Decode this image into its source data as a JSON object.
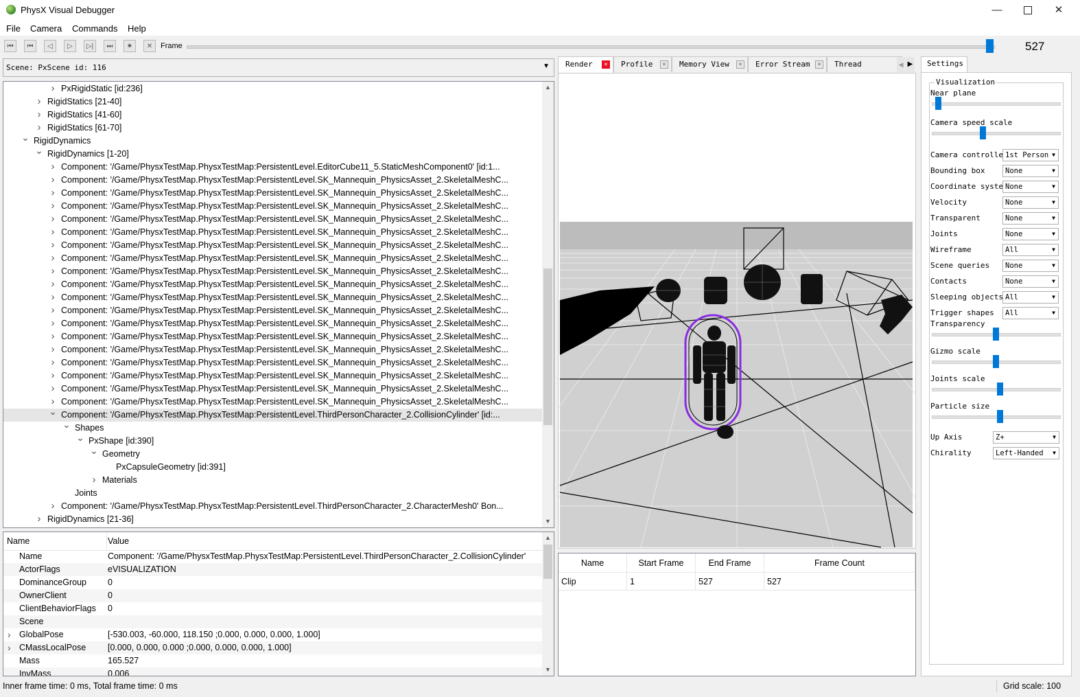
{
  "window": {
    "title": "PhysX Visual Debugger",
    "minimize": "—",
    "maximize": "☐",
    "close": "✕"
  },
  "menu": [
    "File",
    "Camera",
    "Commands",
    "Help"
  ],
  "toolbar": {
    "frame_label": "Frame",
    "frame_value": "527",
    "frame_position": 0.995,
    "buttons": [
      "first-frame-icon",
      "prev-keyframe-icon",
      "step-back-icon",
      "play-icon",
      "step-forward-icon",
      "last-frame-icon",
      "capture-icon",
      "disconnect-icon"
    ]
  },
  "scene": {
    "label": "Scene: PxScene id: 116"
  },
  "tree": [
    {
      "indent": 5,
      "exp": "right",
      "text": "PxRigidStatic [id:236]"
    },
    {
      "indent": 4,
      "exp": "right",
      "text": "RigidStatics [21-40]"
    },
    {
      "indent": 4,
      "exp": "right",
      "text": "RigidStatics [41-60]"
    },
    {
      "indent": 4,
      "exp": "right",
      "text": "RigidStatics [61-70]"
    },
    {
      "indent": 3,
      "exp": "down",
      "text": "RigidDynamics"
    },
    {
      "indent": 4,
      "exp": "down",
      "text": "RigidDynamics [1-20]"
    },
    {
      "indent": 5,
      "exp": "right",
      "text": "Component: '/Game/PhysxTestMap.PhysxTestMap:PersistentLevel.EditorCube11_5.StaticMeshComponent0'  [id:1..."
    },
    {
      "indent": 5,
      "exp": "right",
      "text": "Component: '/Game/PhysxTestMap.PhysxTestMap:PersistentLevel.SK_Mannequin_PhysicsAsset_2.SkeletalMeshC..."
    },
    {
      "indent": 5,
      "exp": "right",
      "text": "Component: '/Game/PhysxTestMap.PhysxTestMap:PersistentLevel.SK_Mannequin_PhysicsAsset_2.SkeletalMeshC..."
    },
    {
      "indent": 5,
      "exp": "right",
      "text": "Component: '/Game/PhysxTestMap.PhysxTestMap:PersistentLevel.SK_Mannequin_PhysicsAsset_2.SkeletalMeshC..."
    },
    {
      "indent": 5,
      "exp": "right",
      "text": "Component: '/Game/PhysxTestMap.PhysxTestMap:PersistentLevel.SK_Mannequin_PhysicsAsset_2.SkeletalMeshC..."
    },
    {
      "indent": 5,
      "exp": "right",
      "text": "Component: '/Game/PhysxTestMap.PhysxTestMap:PersistentLevel.SK_Mannequin_PhysicsAsset_2.SkeletalMeshC..."
    },
    {
      "indent": 5,
      "exp": "right",
      "text": "Component: '/Game/PhysxTestMap.PhysxTestMap:PersistentLevel.SK_Mannequin_PhysicsAsset_2.SkeletalMeshC..."
    },
    {
      "indent": 5,
      "exp": "right",
      "text": "Component: '/Game/PhysxTestMap.PhysxTestMap:PersistentLevel.SK_Mannequin_PhysicsAsset_2.SkeletalMeshC..."
    },
    {
      "indent": 5,
      "exp": "right",
      "text": "Component: '/Game/PhysxTestMap.PhysxTestMap:PersistentLevel.SK_Mannequin_PhysicsAsset_2.SkeletalMeshC..."
    },
    {
      "indent": 5,
      "exp": "right",
      "text": "Component: '/Game/PhysxTestMap.PhysxTestMap:PersistentLevel.SK_Mannequin_PhysicsAsset_2.SkeletalMeshC..."
    },
    {
      "indent": 5,
      "exp": "right",
      "text": "Component: '/Game/PhysxTestMap.PhysxTestMap:PersistentLevel.SK_Mannequin_PhysicsAsset_2.SkeletalMeshC..."
    },
    {
      "indent": 5,
      "exp": "right",
      "text": "Component: '/Game/PhysxTestMap.PhysxTestMap:PersistentLevel.SK_Mannequin_PhysicsAsset_2.SkeletalMeshC..."
    },
    {
      "indent": 5,
      "exp": "right",
      "text": "Component: '/Game/PhysxTestMap.PhysxTestMap:PersistentLevel.SK_Mannequin_PhysicsAsset_2.SkeletalMeshC..."
    },
    {
      "indent": 5,
      "exp": "right",
      "text": "Component: '/Game/PhysxTestMap.PhysxTestMap:PersistentLevel.SK_Mannequin_PhysicsAsset_2.SkeletalMeshC..."
    },
    {
      "indent": 5,
      "exp": "right",
      "text": "Component: '/Game/PhysxTestMap.PhysxTestMap:PersistentLevel.SK_Mannequin_PhysicsAsset_2.SkeletalMeshC..."
    },
    {
      "indent": 5,
      "exp": "right",
      "text": "Component: '/Game/PhysxTestMap.PhysxTestMap:PersistentLevel.SK_Mannequin_PhysicsAsset_2.SkeletalMeshC..."
    },
    {
      "indent": 5,
      "exp": "right",
      "text": "Component: '/Game/PhysxTestMap.PhysxTestMap:PersistentLevel.SK_Mannequin_PhysicsAsset_2.SkeletalMeshC..."
    },
    {
      "indent": 5,
      "exp": "right",
      "text": "Component: '/Game/PhysxTestMap.PhysxTestMap:PersistentLevel.SK_Mannequin_PhysicsAsset_2.SkeletalMeshC..."
    },
    {
      "indent": 5,
      "exp": "right",
      "text": "Component: '/Game/PhysxTestMap.PhysxTestMap:PersistentLevel.SK_Mannequin_PhysicsAsset_2.SkeletalMeshC..."
    },
    {
      "indent": 5,
      "exp": "down",
      "text": "Component: '/Game/PhysxTestMap.PhysxTestMap:PersistentLevel.ThirdPersonCharacter_2.CollisionCylinder'  [id:...",
      "selected": true
    },
    {
      "indent": 6,
      "exp": "down",
      "text": "Shapes"
    },
    {
      "indent": 7,
      "exp": "down",
      "text": "PxShape [id:390]"
    },
    {
      "indent": 8,
      "exp": "down",
      "text": "Geometry"
    },
    {
      "indent": 9,
      "exp": "",
      "text": "PxCapsuleGeometry [id:391]"
    },
    {
      "indent": 8,
      "exp": "right",
      "text": "Materials"
    },
    {
      "indent": 6,
      "exp": "",
      "text": "Joints"
    },
    {
      "indent": 5,
      "exp": "right",
      "text": "Component: '/Game/PhysxTestMap.PhysxTestMap:PersistentLevel.ThirdPersonCharacter_2.CharacterMesh0' Bon..."
    },
    {
      "indent": 4,
      "exp": "right",
      "text": "RigidDynamics [21-36]"
    },
    {
      "indent": 3,
      "exp": "",
      "text": "Articulations"
    }
  ],
  "props": {
    "headers": [
      "Name",
      "Value"
    ],
    "rows": [
      {
        "name": "Name",
        "value": "Component: '/Game/PhysxTestMap.PhysxTestMap:PersistentLevel.ThirdPersonCharacter_2.CollisionCylinder'",
        "exp": false
      },
      {
        "name": "ActorFlags",
        "value": "eVISUALIZATION",
        "exp": false
      },
      {
        "name": "DominanceGroup",
        "value": "0",
        "exp": false
      },
      {
        "name": "OwnerClient",
        "value": "0",
        "exp": false
      },
      {
        "name": "ClientBehaviorFlags",
        "value": "0",
        "exp": false
      },
      {
        "name": "Scene",
        "value": "",
        "exp": false
      },
      {
        "name": "GlobalPose",
        "value": "[-530.003, -60.000, 118.150 ;0.000, 0.000, 0.000, 1.000]",
        "exp": true
      },
      {
        "name": "CMassLocalPose",
        "value": "[0.000, 0.000, 0.000 ;0.000, 0.000, 0.000, 1.000]",
        "exp": true
      },
      {
        "name": "Mass",
        "value": "165.527",
        "exp": false
      },
      {
        "name": "InvMass",
        "value": "0.006",
        "exp": false
      }
    ]
  },
  "tabs": [
    {
      "label": "Render",
      "active": true
    },
    {
      "label": "Profile",
      "active": false
    },
    {
      "label": "Memory View",
      "active": false
    },
    {
      "label": "Error Stream",
      "active": false
    },
    {
      "label": "Thread Profiler",
      "active": false
    }
  ],
  "clips": {
    "headers": [
      "Name",
      "Start Frame",
      "End Frame",
      "Frame Count"
    ],
    "rows": [
      [
        "Clip",
        "1",
        "527",
        "527"
      ]
    ]
  },
  "settings": {
    "tab": "Settings",
    "group": "Visualization",
    "near_plane": {
      "label": "Near plane",
      "value": 0.05
    },
    "camera_speed": {
      "label": "Camera speed scale",
      "value": 0.4
    },
    "combos": [
      {
        "label": "Camera controller",
        "value": "1st Person"
      },
      {
        "label": "Bounding box",
        "value": "None"
      },
      {
        "label": "Coordinate system",
        "value": "None"
      },
      {
        "label": "Velocity",
        "value": "None"
      },
      {
        "label": "Transparent",
        "value": "None"
      },
      {
        "label": "Joints",
        "value": "None"
      },
      {
        "label": "Wireframe",
        "value": "All"
      },
      {
        "label": "Scene queries",
        "value": "None"
      },
      {
        "label": "Contacts",
        "value": "None"
      },
      {
        "label": "Sleeping objects",
        "value": "All"
      },
      {
        "label": "Trigger shapes",
        "value": "All"
      }
    ],
    "sliders": [
      {
        "label": "Transparency",
        "value": 0.5
      },
      {
        "label": "Gizmo scale",
        "value": 0.5
      },
      {
        "label": "Joints scale",
        "value": 0.53
      },
      {
        "label": "Particle size",
        "value": 0.53
      }
    ],
    "up_axis": {
      "label": "Up Axis",
      "value": "Z+"
    },
    "chirality": {
      "label": "Chirality",
      "value": "Left-Handed"
    }
  },
  "status": {
    "left": "Inner frame time: 0 ms, Total frame time: 0 ms",
    "right": "Grid scale: 100"
  },
  "colors": {
    "accent": "#0078d7",
    "selection_highlight": "#8a2be2",
    "close_tab": "#e81123"
  }
}
